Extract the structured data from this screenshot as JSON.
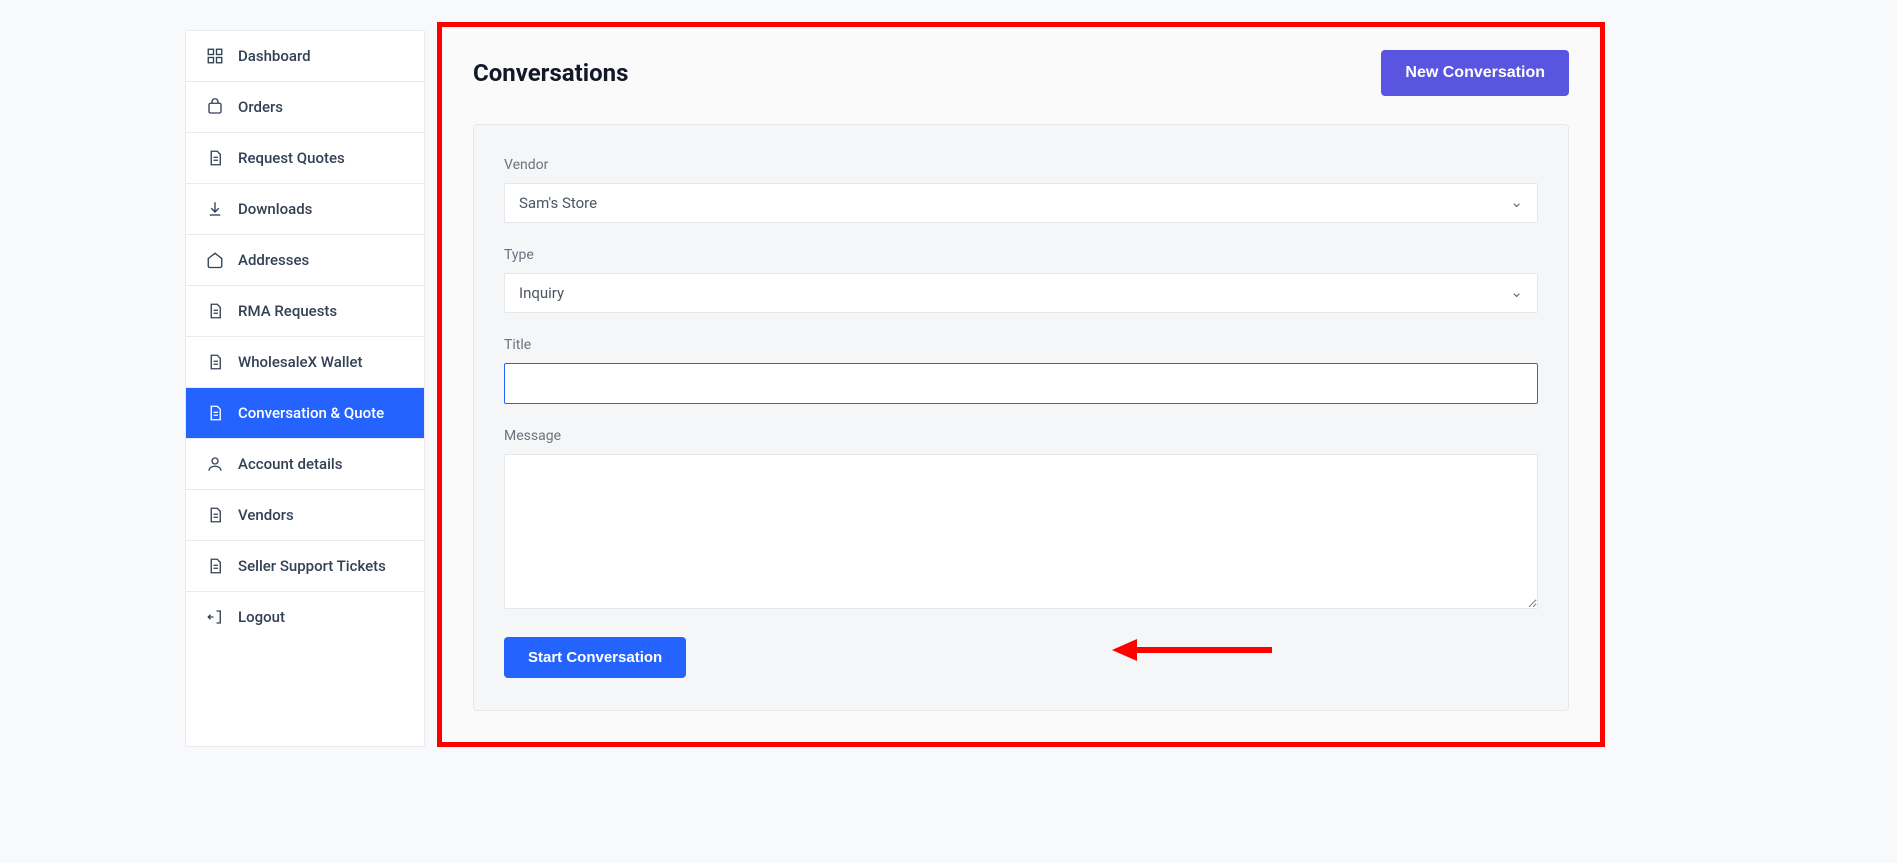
{
  "sidebar": {
    "items": [
      {
        "label": "Dashboard"
      },
      {
        "label": "Orders"
      },
      {
        "label": "Request Quotes"
      },
      {
        "label": "Downloads"
      },
      {
        "label": "Addresses"
      },
      {
        "label": "RMA Requests"
      },
      {
        "label": "WholesaleX Wallet"
      },
      {
        "label": "Conversation & Quote"
      },
      {
        "label": "Account details"
      },
      {
        "label": "Vendors"
      },
      {
        "label": "Seller Support Tickets"
      },
      {
        "label": "Logout"
      }
    ]
  },
  "header": {
    "title": "Conversations",
    "new_button": "New Conversation"
  },
  "form": {
    "vendor_label": "Vendor",
    "vendor_value": "Sam's Store",
    "type_label": "Type",
    "type_value": "Inquiry",
    "title_label": "Title",
    "title_value": "",
    "message_label": "Message",
    "message_value": "",
    "submit_label": "Start Conversation"
  }
}
